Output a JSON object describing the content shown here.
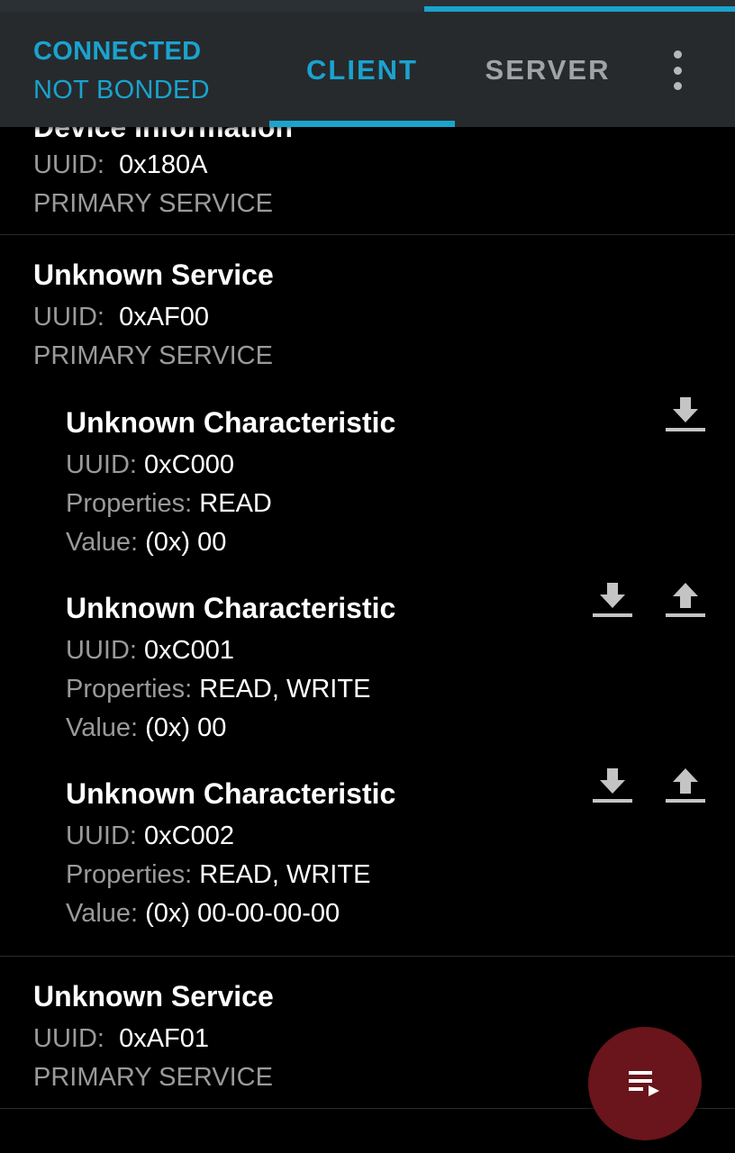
{
  "appbar": {
    "status_connection": "CONNECTED",
    "status_bond": "NOT BONDED",
    "tabs": [
      {
        "label": "CLIENT",
        "active": true
      },
      {
        "label": "SERVER",
        "active": false
      }
    ],
    "overflow_icon": "more-vert-icon",
    "accent_color": "#1aa3cf"
  },
  "services": [
    {
      "title": "Device Information",
      "uuid_label": "UUID:",
      "uuid": "0x180A",
      "type": "PRIMARY SERVICE"
    },
    {
      "title": "Unknown Service",
      "uuid_label": "UUID:",
      "uuid": "0xAF00",
      "type": "PRIMARY SERVICE",
      "characteristics": [
        {
          "title": "Unknown Characteristic",
          "uuid_label": "UUID:",
          "uuid": "0xC000",
          "properties_label": "Properties:",
          "properties": "READ",
          "value_label": "Value:",
          "value": "(0x) 00",
          "actions": [
            "download-icon"
          ]
        },
        {
          "title": "Unknown Characteristic",
          "uuid_label": "UUID:",
          "uuid": "0xC001",
          "properties_label": "Properties:",
          "properties": "READ, WRITE",
          "value_label": "Value:",
          "value": "(0x) 00",
          "actions": [
            "download-icon",
            "upload-icon"
          ]
        },
        {
          "title": "Unknown Characteristic",
          "uuid_label": "UUID:",
          "uuid": "0xC002",
          "properties_label": "Properties:",
          "properties": "READ, WRITE",
          "value_label": "Value:",
          "value": "(0x) 00-00-00-00",
          "actions": [
            "download-icon",
            "upload-icon"
          ]
        }
      ]
    },
    {
      "title": "Unknown Service",
      "uuid_label": "UUID:",
      "uuid": "0xAF01",
      "type": "PRIMARY SERVICE"
    }
  ],
  "fab": {
    "icon": "playlist-play-icon",
    "color": "#6a141b"
  }
}
